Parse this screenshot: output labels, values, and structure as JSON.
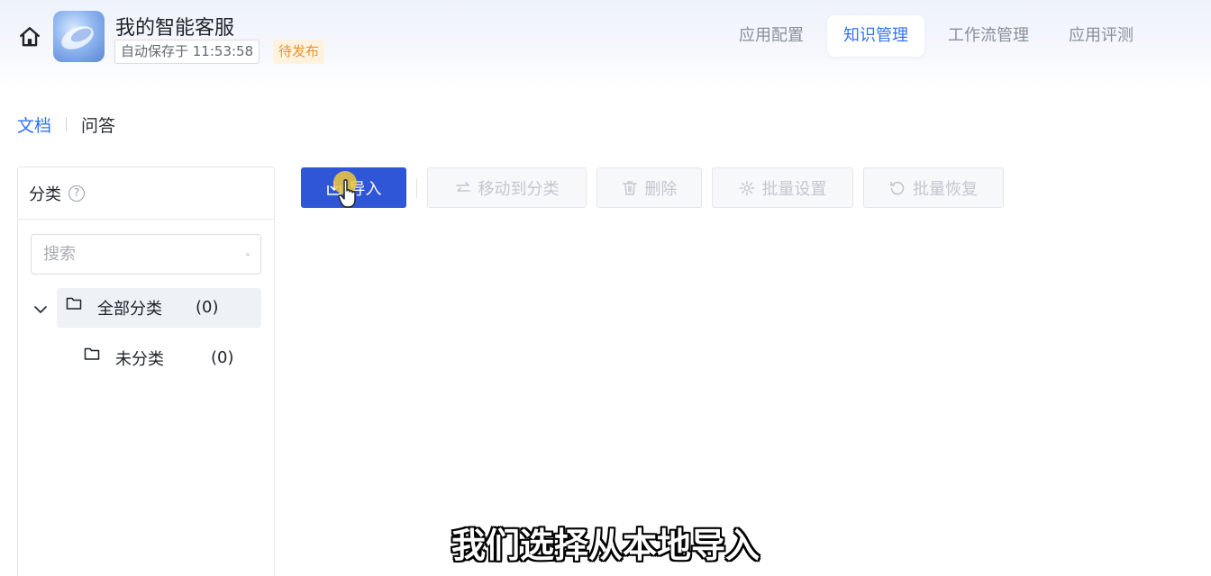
{
  "header": {
    "app_name": "我的智能客服",
    "autosave": "自动保存于 11:53:58",
    "status": "待发布",
    "tabs": [
      {
        "label": "应用配置",
        "active": false
      },
      {
        "label": "知识管理",
        "active": true
      },
      {
        "label": "工作流管理",
        "active": false
      },
      {
        "label": "应用评测",
        "active": false
      }
    ]
  },
  "subtabs": [
    {
      "label": "文档",
      "active": true
    },
    {
      "label": "问答",
      "active": false
    }
  ],
  "sidebar": {
    "title": "分类",
    "search_placeholder": "搜索",
    "tree": {
      "all": {
        "label": "全部分类",
        "count": "(0)"
      },
      "uncategorized": {
        "label": "未分类",
        "count": "(0)"
      }
    }
  },
  "toolbar": {
    "import": "导入",
    "move": "移动到分类",
    "delete": "删除",
    "batch_settings": "批量设置",
    "batch_restore": "批量恢复"
  },
  "caption": "我们选择从本地导入",
  "colors": {
    "accent": "#3370ff",
    "primary_button": "#2f56d6",
    "status_text": "#e8922d",
    "status_bg": "#fff3e0"
  },
  "icons": [
    "home-icon",
    "help-icon",
    "search-icon",
    "chevron-down-icon",
    "folder-icon",
    "import-icon",
    "swap-icon",
    "trash-icon",
    "gear-icon",
    "restore-icon",
    "hand-cursor-icon"
  ]
}
